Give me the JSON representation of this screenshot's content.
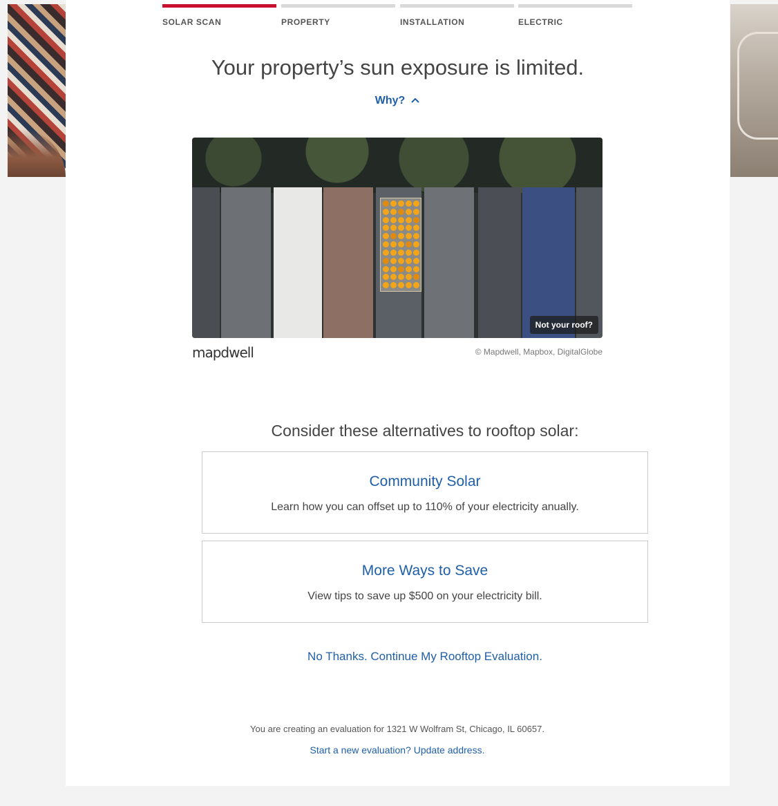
{
  "steps": [
    {
      "label": "SOLAR SCAN",
      "active": true
    },
    {
      "label": "PROPERTY",
      "active": false
    },
    {
      "label": "INSTALLATION",
      "active": false
    },
    {
      "label": "ELECTRIC",
      "active": false
    }
  ],
  "headline": "Your property’s sun exposure is limited.",
  "why_link": "Why?",
  "map": {
    "not_your_roof": "Not your roof?",
    "logo_text": "mapdwell",
    "credit": "© Mapdwell, Mapbox, DigitalGlobe"
  },
  "alternatives": {
    "title": "Consider these alternatives to rooftop solar:",
    "options": [
      {
        "title": "Community Solar",
        "desc": "Learn how you can offset up to 110% of your electricity anually."
      },
      {
        "title": "More Ways to Save",
        "desc": "View tips to save up $500 on your electricity bill."
      }
    ]
  },
  "no_thanks": "No Thanks. Continue My Rooftop Evaluation.",
  "evaluation_note": "You are creating an evaluation for 1321 W Wolfram St, Chicago, IL 60657.",
  "new_evaluation_link": "Start a new evaluation? Update address.",
  "colors": {
    "accent_red": "#c8102e",
    "link_blue": "#1f5fa8",
    "solar_orange": "#f3a51a"
  },
  "icons": {
    "why": "chevron-up-icon"
  }
}
